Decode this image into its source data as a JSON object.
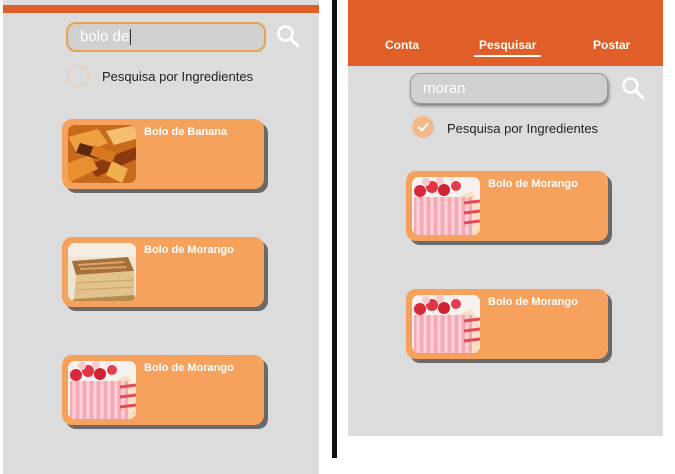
{
  "left_screen": {
    "search": {
      "value": "bolo de"
    },
    "filter": {
      "label": "Pesquisa por Ingredientes",
      "checked": false
    },
    "results": [
      {
        "title": "Bolo de Banana",
        "image": "banana-cake-photo"
      },
      {
        "title": "Bolo de Morango",
        "image": "sliced-cake-photo"
      },
      {
        "title": "Bolo de Morango",
        "image": "strawberry-cake-photo"
      }
    ]
  },
  "right_screen": {
    "nav": [
      {
        "label": "Conta",
        "active": false
      },
      {
        "label": "Pesquisar",
        "active": true
      },
      {
        "label": "Postar",
        "active": false
      }
    ],
    "search": {
      "value": "moran"
    },
    "filter": {
      "label": "Pesquisa por Ingredientes",
      "checked": true
    },
    "results": [
      {
        "title": "Bolo de Morango",
        "image": "strawberry-cake-photo"
      },
      {
        "title": "Bolo de Morango",
        "image": "strawberry-cake-photo"
      }
    ]
  },
  "colors": {
    "brand": "#e05e27",
    "card": "#f6a15c",
    "background": "#dcdcdc",
    "card_shadow": "#6a6a6a"
  }
}
